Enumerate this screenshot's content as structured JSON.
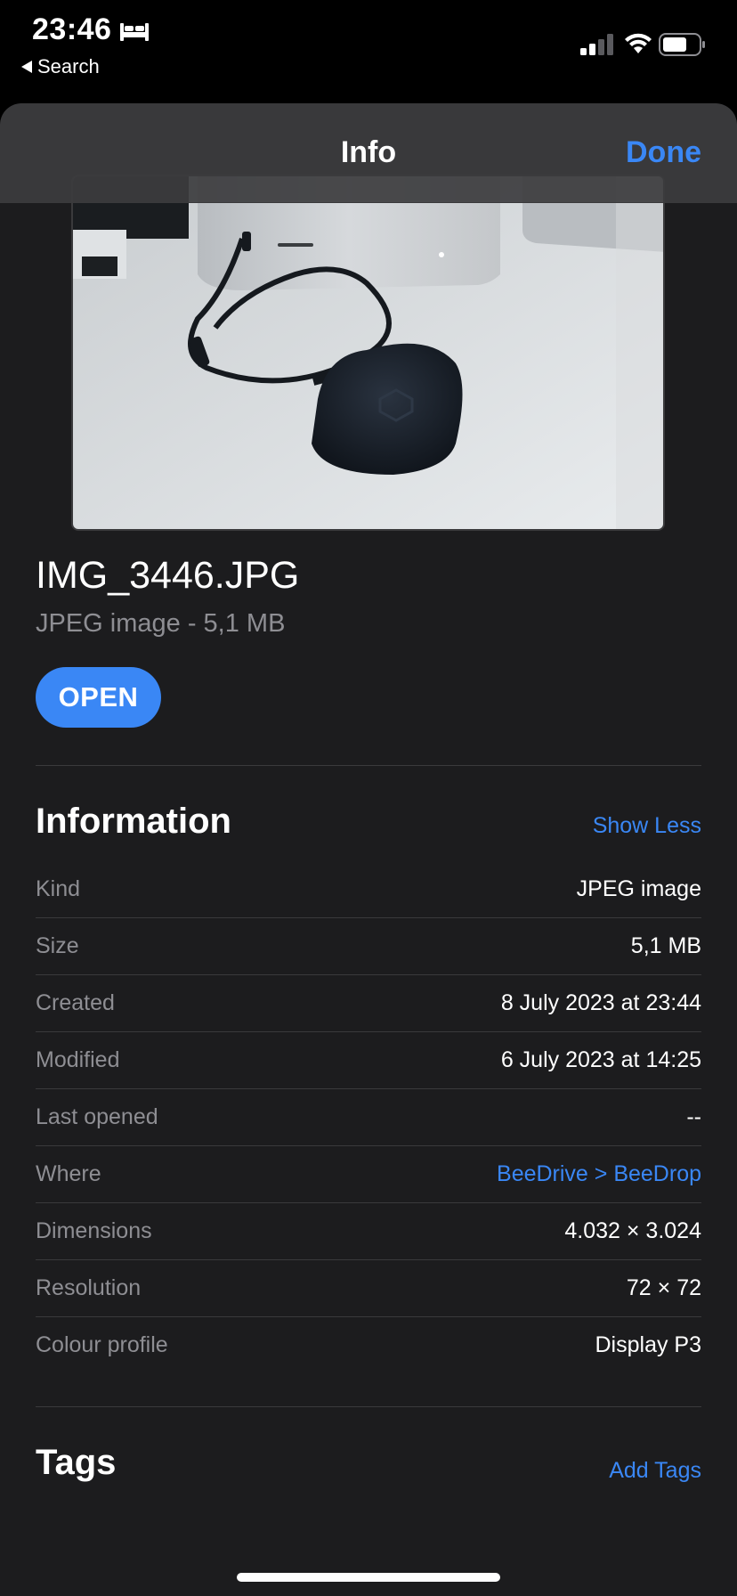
{
  "status_bar": {
    "time": "23:46",
    "back_label": "Search",
    "icons": [
      "bed-icon",
      "signal-icon",
      "wifi-icon",
      "battery-icon"
    ]
  },
  "nav": {
    "title": "Info",
    "done_label": "Done"
  },
  "file": {
    "name": "IMG_3446.JPG",
    "meta": "JPEG image - 5,1 MB",
    "open_label": "OPEN"
  },
  "information": {
    "title": "Information",
    "toggle_label": "Show Less",
    "rows": [
      {
        "key": "Kind",
        "value": "JPEG image"
      },
      {
        "key": "Size",
        "value": "5,1 MB"
      },
      {
        "key": "Created",
        "value": "8 July 2023 at 23:44"
      },
      {
        "key": "Modified",
        "value": "6 July 2023 at 14:25"
      },
      {
        "key": "Last opened",
        "value": "--"
      },
      {
        "key": "Where",
        "value": "BeeDrive > BeeDrop"
      },
      {
        "key": "Dimensions",
        "value": "4.032 × 3.024"
      },
      {
        "key": "Resolution",
        "value": "72 × 72"
      },
      {
        "key": "Colour profile",
        "value": "Display P3"
      }
    ]
  },
  "tags": {
    "title": "Tags",
    "add_label": "Add Tags"
  },
  "colors": {
    "accent": "#3a87f5",
    "background": "#1c1c1e",
    "secondary_text": "#8e8e93"
  }
}
